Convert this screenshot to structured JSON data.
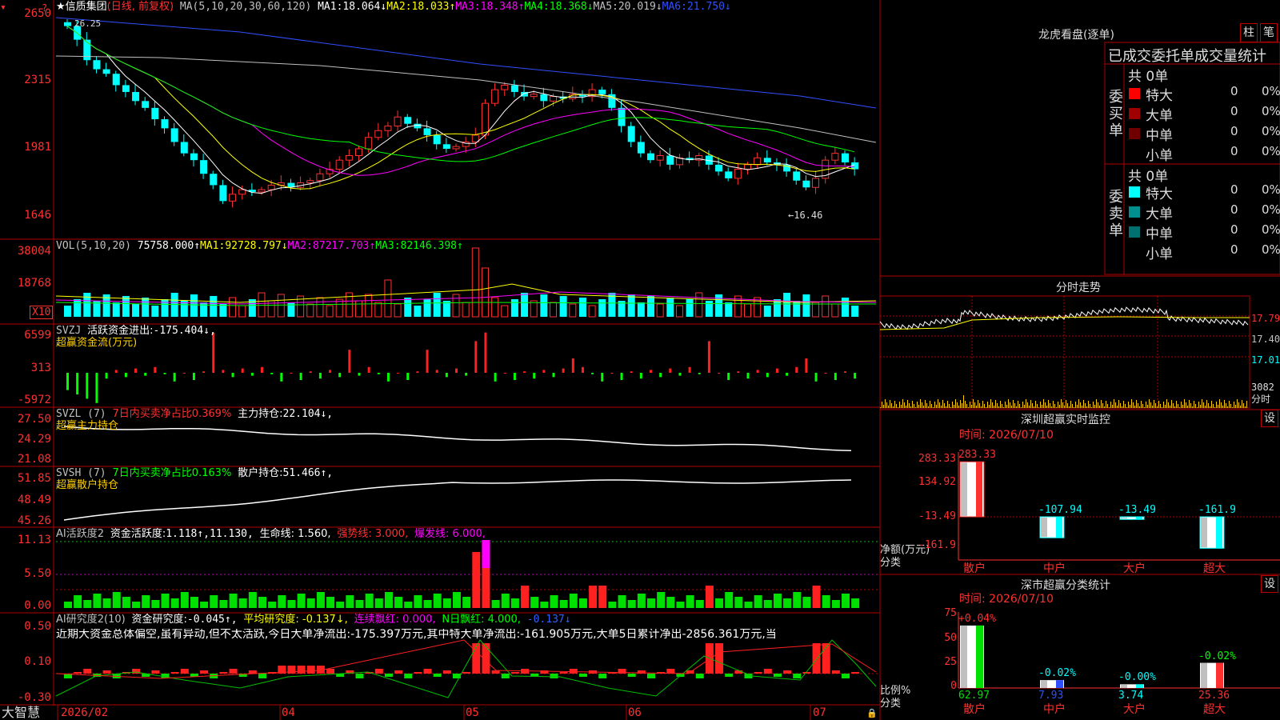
{
  "main": {
    "title": "★信质集团",
    "mode": "(日线, 前复权)",
    "ma_header": "MA(5,10,20,30,60,120)",
    "ma_values": [
      {
        "label": "MA1:",
        "value": "18.064↓",
        "color": "#ffffff"
      },
      {
        "label": "MA2:",
        "value": "18.033↑",
        "color": "#ffff00"
      },
      {
        "label": "MA3:",
        "value": "18.348↑",
        "color": "#ff00ff"
      },
      {
        "label": "MA4:",
        "value": "18.368↓",
        "color": "#00ff00"
      },
      {
        "label": "MA5:",
        "value": "20.019↓",
        "color": "#c0c0c0"
      },
      {
        "label": "MA6:",
        "value": "21.750↓",
        "color": "#3050ff"
      }
    ],
    "yticks": [
      "2650",
      "2315",
      "1981",
      "1646"
    ],
    "high_label": "26.25",
    "low_label": "←16.46"
  },
  "vol": {
    "header": "VOL(5,10,20)",
    "value": "75758.000↑",
    "ma": [
      {
        "label": "MA1:",
        "value": "92728.797↓",
        "color": "#ffff00"
      },
      {
        "label": "MA2:",
        "value": "87217.703↑",
        "color": "#ff00ff"
      },
      {
        "label": "MA3:",
        "value": "82146.398↑",
        "color": "#00ff00"
      }
    ],
    "yticks": [
      "38004",
      "18768"
    ],
    "unit": "X10"
  },
  "svzj": {
    "header": "SVZJ",
    "label": "活跃资金进出:",
    "value": "-175.404↓,",
    "sub": "超赢资金流(万元)",
    "yticks": [
      "6599",
      "313",
      "-5972"
    ]
  },
  "svzl": {
    "header": "SVZL (7)",
    "desc": "7日内买卖净占比0.369%",
    "label": "主力持仓:",
    "value": "22.104↓,",
    "sub": "超赢主力持仓",
    "yticks": [
      "27.50",
      "24.29",
      "21.08"
    ]
  },
  "svsh": {
    "header": "SVSH (7)",
    "desc": "7日内买卖净占比0.163%",
    "label": "散户持仓:",
    "value": "51.466↑,",
    "sub": "超赢散户持仓",
    "yticks": [
      "51.85",
      "48.49",
      "45.26"
    ]
  },
  "ai1": {
    "header": "AI活跃度2",
    "label": "资金活跃度:",
    "v1": "1.118↑,",
    "v2": "11.130,",
    "life": "生命线: 1.560,",
    "strong": "强势线: 3.000,",
    "burst": "爆发线: 6.000,",
    "yticks": [
      "11.13",
      "5.50",
      "0.00"
    ]
  },
  "ai2": {
    "header": "AI研究度2(10)",
    "label": "资金研究度:",
    "v1": "-0.045↑,",
    "avg": "平均研究度: -0.137↓,",
    "red": "连续飘红: 0.000,",
    "nred": "N日飘红: 4.000,",
    "last": "-0.137↓",
    "comment": "近期大资金总体偏空,虽有异动,但不太活跃,今日大单净流出:-175.397万元,其中特大单净流出:-161.905万元,大单5日累计净出-2856.361万元,当",
    "yticks": [
      "0.50",
      "0.10",
      "-0.30"
    ]
  },
  "xaxis": {
    "labels": [
      "2026/02",
      "04",
      "05",
      "06",
      "07"
    ],
    "brand": "大智慧"
  },
  "dragon": {
    "title": "龙虎看盘(逐单)",
    "btn_bar": "柱",
    "btn_pen": "笔",
    "header": "已成交委托单成交量统计",
    "buy": {
      "side": "委买单",
      "total": "共 0单",
      "rows": [
        {
          "name": "特大",
          "count": "0",
          "pct": "0%",
          "color": "#ff0000"
        },
        {
          "name": "大单",
          "count": "0",
          "pct": "0%",
          "color": "#a00000"
        },
        {
          "name": "中单",
          "count": "0",
          "pct": "0%",
          "color": "#700000"
        },
        {
          "name": "小单",
          "count": "0",
          "pct": "0%",
          "color": "#000000"
        }
      ]
    },
    "sell": {
      "side": "委卖单",
      "total": "共 0单",
      "rows": [
        {
          "name": "特大",
          "count": "0",
          "pct": "0%",
          "color": "#00ffff"
        },
        {
          "name": "大单",
          "count": "0",
          "pct": "0%",
          "color": "#009090"
        },
        {
          "name": "中单",
          "count": "0",
          "pct": "0%",
          "color": "#007070"
        },
        {
          "name": "小单",
          "count": "0",
          "pct": "0%",
          "color": "#000000"
        }
      ]
    }
  },
  "intraday": {
    "title": "分时走势",
    "prices": [
      "17.79",
      "17.40",
      "17.01"
    ],
    "vol": "3082",
    "unit": "分时"
  },
  "monitor": {
    "title": "深圳超赢实时监控",
    "btn": "设",
    "date": "时间: 2026/07/10",
    "yticks": [
      "283.33",
      "134.92",
      "-13.49",
      "-161.9"
    ],
    "ylabel1": "净额(万元)",
    "ylabel2": "分类",
    "categories": [
      "散户",
      "中户",
      "大户",
      "超大"
    ],
    "values": [
      "283.33",
      "-107.94",
      "-13.49",
      "-161.9"
    ]
  },
  "stats": {
    "title": "深市超赢分类统计",
    "btn": "设",
    "date": "时间: 2026/07/10",
    "yticks": [
      "75",
      "50",
      "25",
      "0"
    ],
    "ylabel1": "比例%",
    "ylabel2": "分类",
    "categories": [
      "散户",
      "中户",
      "大户",
      "超大"
    ],
    "changes": [
      "+0.04%",
      "-0.02%",
      "-0.00%",
      "-0.02%"
    ],
    "values": [
      "62.97",
      "7.93",
      "3.74",
      "25.36"
    ]
  }
}
